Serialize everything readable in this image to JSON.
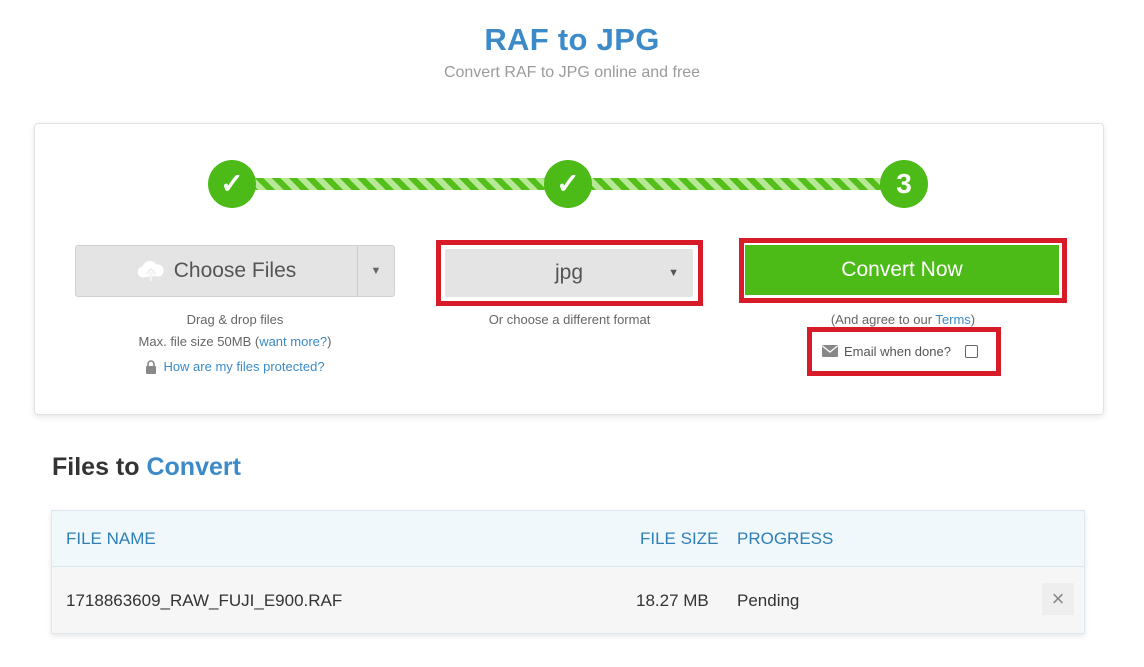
{
  "header": {
    "title": "RAF to JPG",
    "subtitle": "Convert RAF to JPG online and free"
  },
  "steps": {
    "step1": "✓",
    "step2": "✓",
    "step3": "3"
  },
  "choose_files": {
    "label": "Choose Files",
    "drag_drop": "Drag & drop files",
    "max_size_prefix": "Max. file size 50MB (",
    "want_more": "want more?",
    "max_size_suffix": ")",
    "protected_link": "How are my files protected?"
  },
  "format": {
    "selected": "jpg",
    "hint": "Or choose a different format"
  },
  "convert": {
    "label": "Convert Now",
    "agree_prefix": "(And agree to our ",
    "terms_link": "Terms",
    "agree_suffix": ")",
    "email_label": "Email when done?"
  },
  "files": {
    "title_prefix": "Files to ",
    "title_accent": "Convert",
    "columns": {
      "name": "FILE NAME",
      "size": "FILE SIZE",
      "progress": "PROGRESS"
    },
    "rows": [
      {
        "name": "1718863609_RAW_FUJI_E900.RAF",
        "size": "18.27 MB",
        "progress": "Pending",
        "remove": "×"
      }
    ]
  },
  "colors": {
    "accent_blue": "#3c8ac8",
    "convert_green": "#4cbb17",
    "highlight_red": "#d71b28"
  }
}
